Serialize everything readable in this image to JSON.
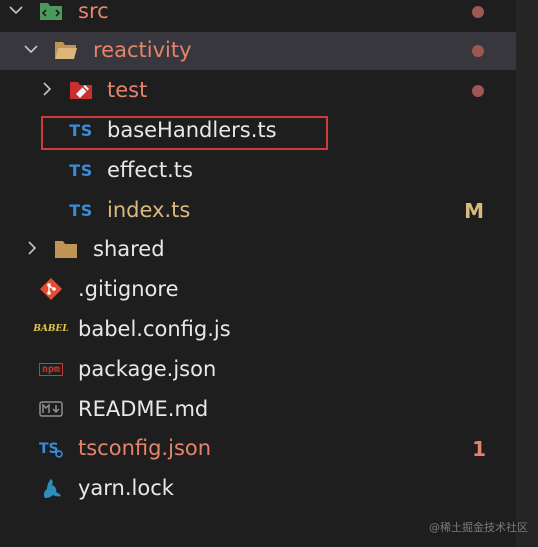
{
  "explorer": {
    "items": [
      {
        "label": "src",
        "status": "modified-dot"
      },
      {
        "label": "reactivity",
        "status": "modified-dot"
      },
      {
        "label": "test",
        "status": "modified-dot"
      },
      {
        "label": "baseHandlers.ts"
      },
      {
        "label": "effect.ts"
      },
      {
        "label": "index.ts",
        "badge": "M"
      },
      {
        "label": "shared"
      },
      {
        "label": ".gitignore"
      },
      {
        "label": "babel.config.js"
      },
      {
        "label": "package.json"
      },
      {
        "label": "README.md"
      },
      {
        "label": "tsconfig.json",
        "badge": "1"
      },
      {
        "label": "yarn.lock"
      }
    ],
    "icons": {
      "ts": "TS",
      "babel": "BABEL",
      "npm": "npm"
    },
    "colors": {
      "modified": "#e5846b",
      "changed": "#d7ba7d",
      "selection_outline": "#d13a3a",
      "typescript_blue": "#3c8ad8"
    }
  },
  "watermark": "@稀土掘金技术社区"
}
